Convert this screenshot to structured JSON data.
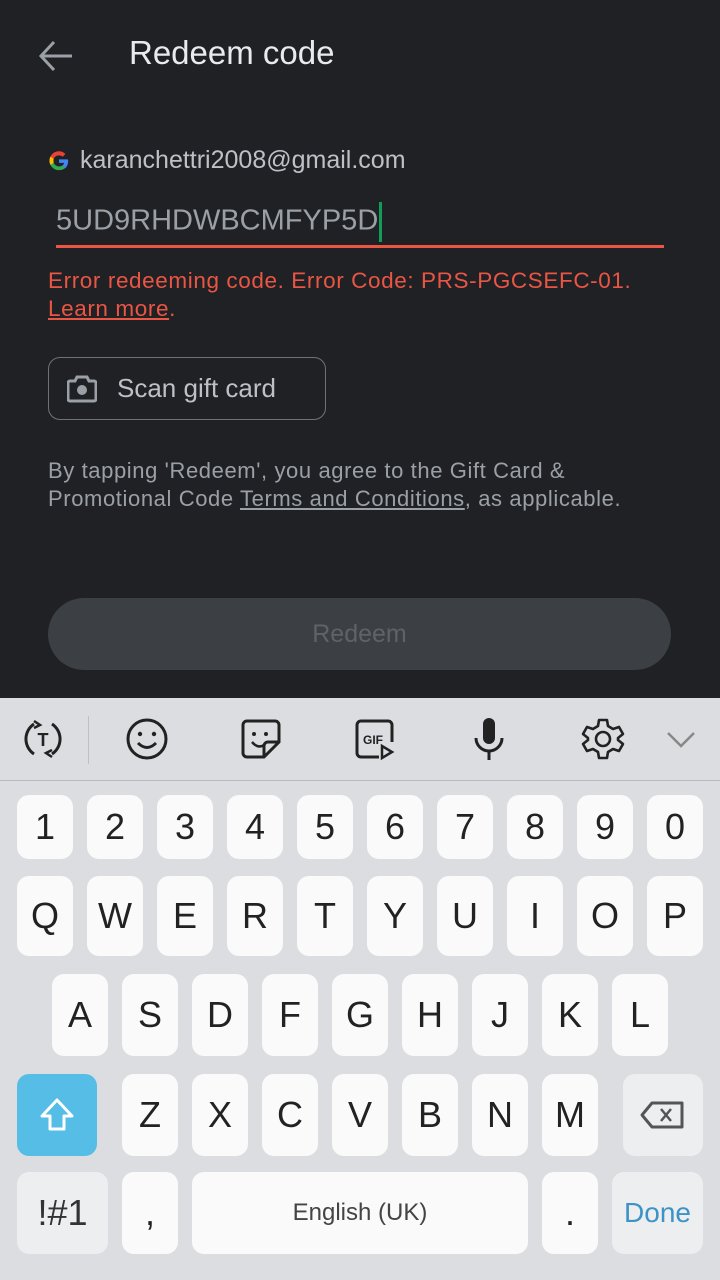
{
  "header": {
    "title": "Redeem code",
    "back_icon": "arrow-left-icon"
  },
  "account": {
    "icon": "google-g-icon",
    "email": "karanchettri2008@gmail.com"
  },
  "code_input": {
    "value": "5UD9RHDWBCMFYP5D"
  },
  "error": {
    "message": "Error redeeming code. Error Code: PRS-PGCSEFC-01.",
    "link": "Learn more",
    "suffix": "."
  },
  "scan_button": {
    "label": "Scan gift card",
    "icon": "camera-icon"
  },
  "terms": {
    "prefix": "By tapping 'Redeem', you agree to the Gift Card & Promotional Code ",
    "link": "Terms and Conditions",
    "suffix": ", as applicable."
  },
  "redeem_button": {
    "label": "Redeem",
    "enabled": false
  },
  "colors": {
    "background": "#202124",
    "error": "#ea5544",
    "caret": "#0f9d58",
    "shift_active": "#55bde6",
    "done": "#3d93c6"
  },
  "keyboard": {
    "toolbar": [
      "text-translate-icon",
      "emoji-icon",
      "sticker-icon",
      "gif-icon",
      "microphone-icon",
      "settings-gear-icon",
      "chevron-down-icon"
    ],
    "row_numbers": [
      "1",
      "2",
      "3",
      "4",
      "5",
      "6",
      "7",
      "8",
      "9",
      "0"
    ],
    "row_1": [
      "Q",
      "W",
      "E",
      "R",
      "T",
      "Y",
      "U",
      "I",
      "O",
      "P"
    ],
    "row_2": [
      "A",
      "S",
      "D",
      "F",
      "G",
      "H",
      "J",
      "K",
      "L"
    ],
    "row_3": [
      "Z",
      "X",
      "C",
      "V",
      "B",
      "N",
      "M"
    ],
    "symbols_label": "!#1",
    "comma": ",",
    "space_label": "English (UK)",
    "period": ".",
    "done_label": "Done"
  }
}
